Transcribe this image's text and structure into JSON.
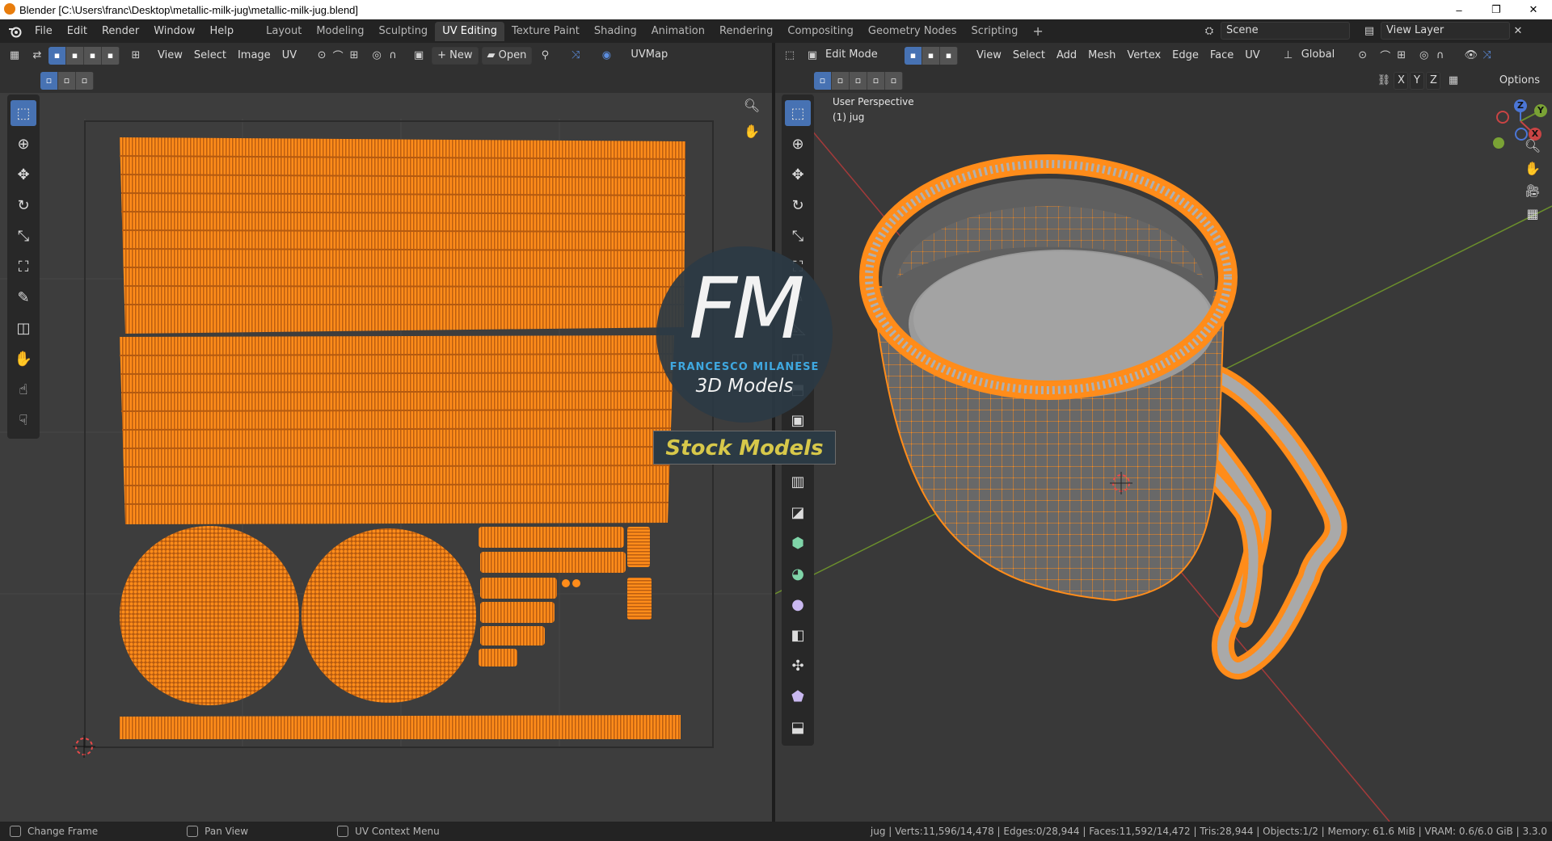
{
  "window": {
    "title": "Blender [C:\\Users\\franc\\Desktop\\metallic-milk-jug\\metallic-milk-jug.blend]",
    "controls": [
      "–",
      "❐",
      "✕"
    ]
  },
  "menubar": {
    "items": [
      "File",
      "Edit",
      "Render",
      "Window",
      "Help"
    ]
  },
  "workspaces": {
    "tabs": [
      "Layout",
      "Modeling",
      "Sculpting",
      "UV Editing",
      "Texture Paint",
      "Shading",
      "Animation",
      "Rendering",
      "Compositing",
      "Geometry Nodes",
      "Scripting"
    ],
    "active": "UV Editing",
    "add": "+"
  },
  "scene": {
    "name": "Scene",
    "view_layer": "View Layer"
  },
  "uv_editor": {
    "menus": [
      "View",
      "Select",
      "Image",
      "UV"
    ],
    "new_label": "New",
    "open_label": "Open",
    "uvmap": "UVMap"
  },
  "viewport": {
    "mode": "Edit Mode",
    "menus": [
      "View",
      "Select",
      "Add",
      "Mesh",
      "Vertex",
      "Edge",
      "Face",
      "UV"
    ],
    "orientation": "Global",
    "axes": [
      "X",
      "Y",
      "Z"
    ],
    "options_label": "Options",
    "perspective": "User Perspective",
    "object": "(1) jug",
    "gizmo": {
      "x": "X",
      "y": "Y",
      "z": "Z"
    }
  },
  "watermark": {
    "logo": "FM",
    "name": "FRANCESCO MILANESE",
    "sub": "3D Models",
    "badge": "Stock Models"
  },
  "status": {
    "items": [
      "Change Frame",
      "Pan View",
      "UV Context Menu"
    ],
    "stats": "jug | Verts:11,596/14,478 | Edges:0/28,944 | Faces:11,592/14,472 | Tris:28,944 | Objects:1/2 | Memory: 61.6 MiB | VRAM: 0.6/6.0 GiB | 3.3.0"
  },
  "colors": {
    "selection": "#ff8c1a",
    "accent": "#4772b3",
    "bg": "#3d3d3d"
  }
}
